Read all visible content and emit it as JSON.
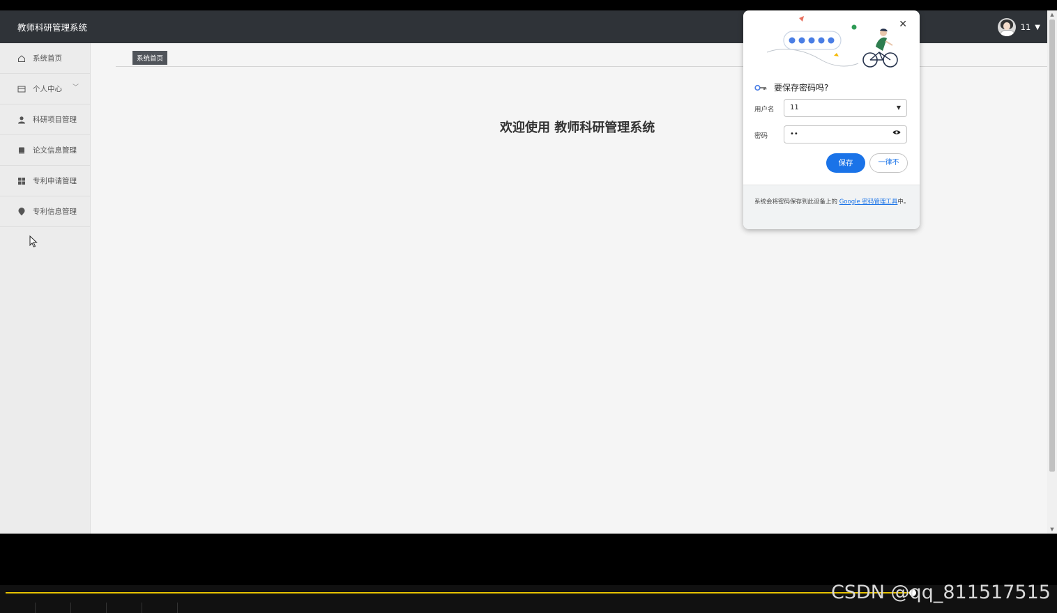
{
  "header": {
    "app_title": "教师科研管理系统",
    "username": "11"
  },
  "sidebar": {
    "items": [
      {
        "label": "系统首页",
        "icon": "home-icon"
      },
      {
        "label": "个人中心",
        "icon": "id-card-icon",
        "has_chevron": true
      },
      {
        "label": "科研项目管理",
        "icon": "user-icon"
      },
      {
        "label": "论文信息管理",
        "icon": "book-icon"
      },
      {
        "label": "专利申请管理",
        "icon": "grid-icon"
      },
      {
        "label": "专利信息管理",
        "icon": "location-pin-icon"
      }
    ]
  },
  "breadcrumb": {
    "label": "系统首页"
  },
  "main": {
    "welcome": "欢迎使用 教师科研管理系统"
  },
  "password_popup": {
    "title": "要保存密码吗?",
    "username_label": "用户名",
    "username_value": "11",
    "password_label": "密码",
    "password_value": "••",
    "save_label": "保存",
    "never_label": "一律不",
    "note_prefix": "系统会将密码保存到此设备上的",
    "note_link": "Google 密码管理工具",
    "note_suffix": "中。"
  },
  "watermark": "CSDN @qq_811517515",
  "colors": {
    "header_bg": "#2f3338",
    "accent_blue": "#1a73e8",
    "progress": "#e6c200"
  }
}
